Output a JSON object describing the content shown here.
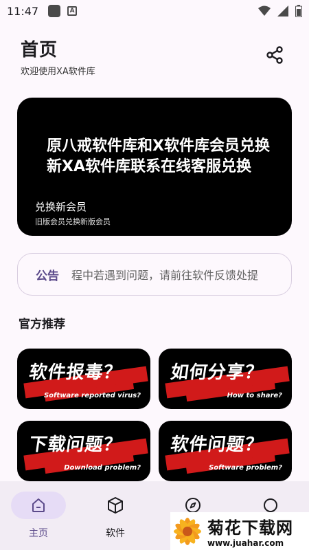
{
  "status_bar": {
    "time": "11:47"
  },
  "header": {
    "title": "首页",
    "subtitle": "欢迎使用XA软件库"
  },
  "banner": {
    "headline": "原八戒软件库和X软件库会员兑换新XA软件库联系在线客服兑换",
    "line1": "兑换新会员",
    "line2": "旧版会员兑换新版会员"
  },
  "notice": {
    "tag": "公告",
    "text": "程中若遇到问题，请前往软件反馈处提"
  },
  "section": {
    "title": "官方推荐"
  },
  "cards": [
    {
      "main": "软件报毒？",
      "sub": "Software reported virus?"
    },
    {
      "main": "如何分享？",
      "sub": "How to share?"
    },
    {
      "main": "下载问题？",
      "sub": "Download problem?"
    },
    {
      "main": "软件问题？",
      "sub": "Software problem?"
    }
  ],
  "nav": [
    {
      "label": "主页",
      "icon": "home-icon"
    },
    {
      "label": "软件",
      "icon": "cube-icon"
    },
    {
      "label": "",
      "icon": "compass-icon"
    },
    {
      "label": "",
      "icon": "circle-icon"
    }
  ],
  "watermark": {
    "title": "菊花下载网",
    "url": "www.juahar.com"
  },
  "colors": {
    "accent": "#5b4a8a",
    "nav_bg": "#f2ecf4",
    "active_pill": "#e6dcf6",
    "red": "#d11a1a"
  }
}
